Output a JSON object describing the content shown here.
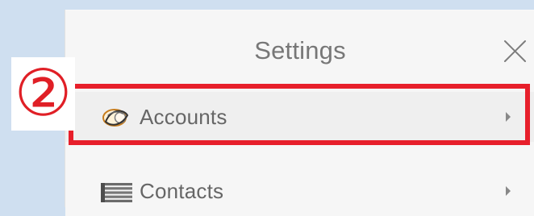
{
  "annotation": {
    "step_marker": "②",
    "highlight_color": "#e71f2b"
  },
  "settings": {
    "title": "Settings",
    "close_icon": "close-icon",
    "items": [
      {
        "label": "Accounts",
        "icon": "accounts-icon",
        "chevron": "chevron-right-icon"
      },
      {
        "label": "Contacts",
        "icon": "contacts-icon",
        "chevron": "chevron-right-icon"
      }
    ]
  }
}
